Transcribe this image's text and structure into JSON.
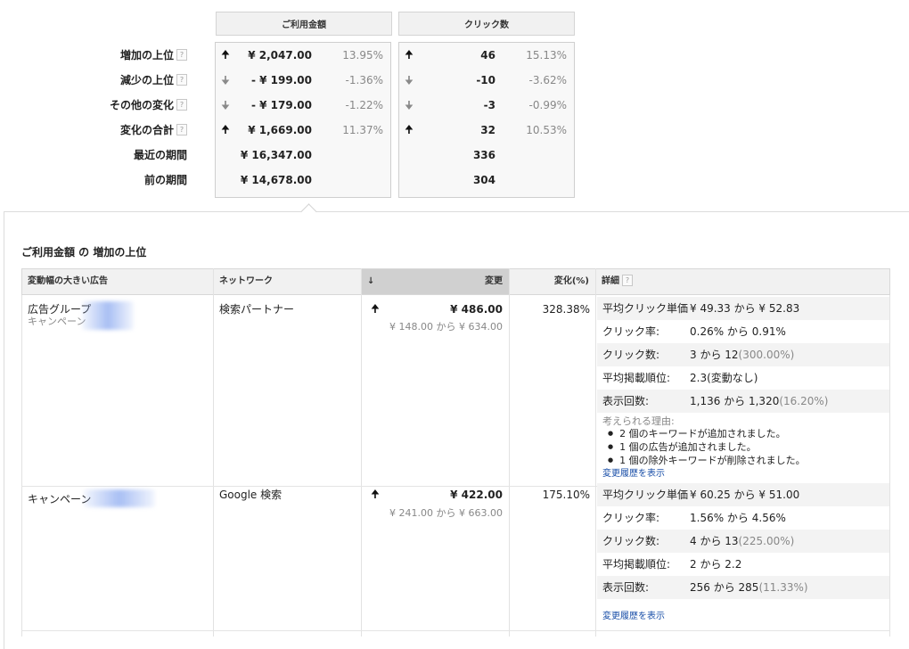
{
  "summary": {
    "columns": {
      "cost": "ご利用金額",
      "clicks": "クリック数"
    },
    "help_glyph": "?",
    "rows": [
      {
        "label": "増加の上位",
        "has_help": true,
        "arrow": "up",
        "cost": "¥ 2,047.00",
        "cost_pct": "13.95%",
        "clicks": "46",
        "clicks_pct": "15.13%"
      },
      {
        "label": "減少の上位",
        "has_help": true,
        "arrow": "down",
        "cost": "- ¥ 199.00",
        "cost_pct": "-1.36%",
        "clicks": "-10",
        "clicks_pct": "-3.62%"
      },
      {
        "label": "その他の変化",
        "has_help": true,
        "arrow": "down",
        "cost": "- ¥ 179.00",
        "cost_pct": "-1.22%",
        "clicks": "-3",
        "clicks_pct": "-0.99%"
      },
      {
        "label": "変化の合計",
        "has_help": true,
        "arrow": "up",
        "cost": "¥ 1,669.00",
        "cost_pct": "11.37%",
        "clicks": "32",
        "clicks_pct": "10.53%"
      },
      {
        "label": "最近の期間",
        "has_help": false,
        "arrow": "",
        "cost": "¥ 16,347.00",
        "cost_pct": "",
        "clicks": "336",
        "clicks_pct": ""
      },
      {
        "label": "前の期間",
        "has_help": false,
        "arrow": "",
        "cost": "¥ 14,678.00",
        "cost_pct": "",
        "clicks": "304",
        "clicks_pct": ""
      }
    ]
  },
  "section_title": "ご利用金額 の 増加の上位",
  "table": {
    "headers": {
      "ad": "変動幅の大きい広告",
      "network": "ネットワーク",
      "sort_arrow": "↓",
      "change": "変更",
      "change_pct": "変化(%)",
      "details": "詳細"
    },
    "rows": [
      {
        "name": "広告グループ",
        "sub": "キャンペーン",
        "network": "検索パートナー",
        "arrow": "up",
        "change": "¥ 486.00",
        "range": "¥ 148.00 から ¥ 634.00",
        "pct": "328.38%",
        "details": [
          {
            "label": "平均クリック単価",
            "value": "¥ 49.33 から ¥ 52.83",
            "paren": ""
          },
          {
            "label": "クリック率:",
            "value": "0.26% から 0.91%",
            "paren": ""
          },
          {
            "label": "クリック数:",
            "value": "3 から 12",
            "paren": "(300.00%)"
          },
          {
            "label": "平均掲載順位:",
            "value": "2.3(変動なし)",
            "paren": ""
          },
          {
            "label": "表示回数:",
            "value": "1,136 から 1,320",
            "paren": "(16.20%)"
          }
        ],
        "reasons_head": "考えられる理由:",
        "reasons": [
          "2 個のキーワードが追加されました。",
          "1 個の広告が追加されました。",
          "1 個の除外キーワードが削除されました。"
        ],
        "history_link": "変更履歴を表示"
      },
      {
        "name": "キャンペーン",
        "sub": "",
        "network": "Google 検索",
        "arrow": "up",
        "change": "¥ 422.00",
        "range": "¥ 241.00 から ¥ 663.00",
        "pct": "175.10%",
        "details": [
          {
            "label": "平均クリック単価",
            "value": "¥ 60.25 から ¥ 51.00",
            "paren": ""
          },
          {
            "label": "クリック率:",
            "value": "1.56% から 4.56%",
            "paren": ""
          },
          {
            "label": "クリック数:",
            "value": "4 から 13",
            "paren": "(225.00%)"
          },
          {
            "label": "平均掲載順位:",
            "value": "2 から 2.2",
            "paren": ""
          },
          {
            "label": "表示回数:",
            "value": "256 から 285",
            "paren": "(11.33%)"
          }
        ],
        "history_link": "変更履歴を表示"
      }
    ]
  }
}
